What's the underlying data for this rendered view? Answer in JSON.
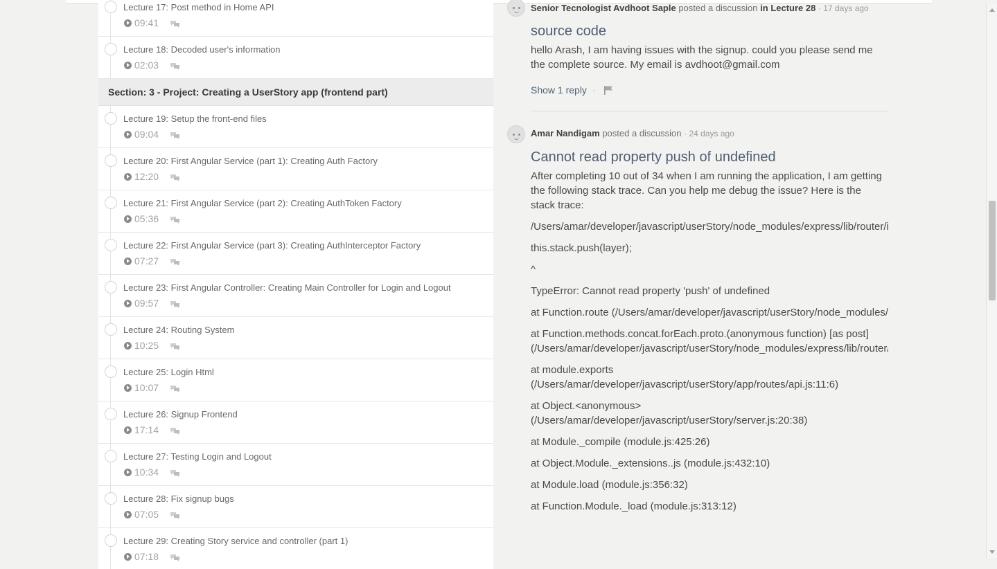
{
  "curriculum": {
    "items": [
      {
        "kind": "lecture",
        "title": "Lecture 17: Post method in Home API",
        "duration": "09:41"
      },
      {
        "kind": "lecture",
        "title": "Lecture 18: Decoded user's information",
        "duration": "02:03"
      },
      {
        "kind": "section",
        "title": "Section: 3 - Project: Creating a UserStory app (frontend part)"
      },
      {
        "kind": "lecture",
        "title": "Lecture 19: Setup the front-end files",
        "duration": "09:04"
      },
      {
        "kind": "lecture",
        "title": "Lecture 20: First Angular Service (part 1): Creating Auth Factory",
        "duration": "12:20"
      },
      {
        "kind": "lecture",
        "title": "Lecture 21: First Angular Service (part 2): Creating AuthToken Factory",
        "duration": "05:36"
      },
      {
        "kind": "lecture",
        "title": "Lecture 22: First Angular Service (part 3): Creating AuthInterceptor Factory",
        "duration": "07:27"
      },
      {
        "kind": "lecture",
        "title": "Lecture 23: First Angular Controller: Creating Main Controller for Login and Logout",
        "duration": "09:57"
      },
      {
        "kind": "lecture",
        "title": "Lecture 24: Routing System",
        "duration": "10:25"
      },
      {
        "kind": "lecture",
        "title": "Lecture 25: Login Html",
        "duration": "10:07"
      },
      {
        "kind": "lecture",
        "title": "Lecture 26: Signup Frontend",
        "duration": "17:14"
      },
      {
        "kind": "lecture",
        "title": "Lecture 27: Testing Login and Logout",
        "duration": "10:34"
      },
      {
        "kind": "lecture",
        "title": "Lecture 28: Fix signup bugs",
        "duration": "07:05"
      },
      {
        "kind": "lecture",
        "title": "Lecture 29: Creating Story service and controller (part 1)",
        "duration": "07:18"
      }
    ]
  },
  "discussions": [
    {
      "author": "Senior Tecnologist Avdhoot Saple",
      "action": "posted a discussion",
      "in_text": "in",
      "lecture_ref": "Lecture 28",
      "ago": "· 17 days ago",
      "title": "source code",
      "body": [
        "hello Arash, I am having issues with the signup. could you please send me the complete source. My email is avdhoot@gmail.com"
      ],
      "replies_label": "Show 1 reply",
      "separator": "·"
    },
    {
      "author": "Amar Nandigam",
      "action": "posted a discussion",
      "ago": "· 24 days ago",
      "title": "Cannot read property push of undefined",
      "body": [
        "After completing 10 out of 34 when I am running the application, I am getting the following stack trace. Can you help me debug the issue? Here is the stack trace:",
        "/Users/amar/developer/javascript/userStory/node_modules/express/lib/router/index.js",
        "this.stack.push(layer);",
        "^",
        "TypeError: Cannot read property 'push' of undefined",
        "at Function.route (/Users/amar/developer/javascript/userStory/node_modules/express/lib/router/index.js",
        "at Function.methods.concat.forEach.proto.(anonymous function) [as post] (/Users/amar/developer/javascript/userStory/node_modules/express/lib/router/index.js",
        "at module.exports (/Users/amar/developer/javascript/userStory/app/routes/api.js:11:6)",
        "at Object.<anonymous> (/Users/amar/developer/javascript/userStory/server.js:20:38)",
        "at Module._compile (module.js:425:26)",
        "at Object.Module._extensions..js (module.js:432:10)",
        "at Module.load (module.js:356:32)",
        "at Function.Module._load (module.js:313:12)"
      ]
    }
  ]
}
